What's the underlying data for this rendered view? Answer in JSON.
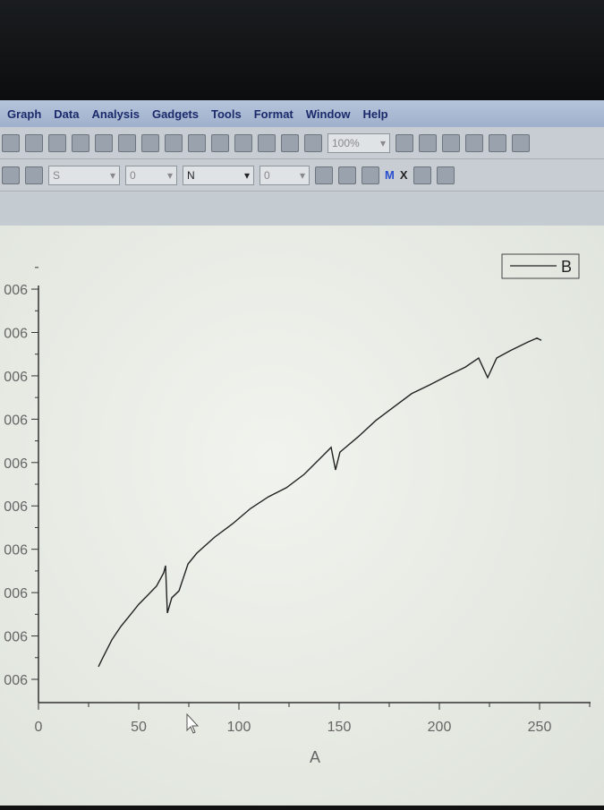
{
  "menu": [
    "Graph",
    "Data",
    "Analysis",
    "Gadgets",
    "Tools",
    "Format",
    "Window",
    "Help"
  ],
  "toolbar": {
    "zoom": "100%",
    "line_style": "S",
    "size1": "0",
    "font": "N",
    "size2": "0",
    "bold_m": "M",
    "x_btn": "X"
  },
  "chart_data": {
    "type": "line",
    "xlabel": "A",
    "ylabel": "",
    "xlim": [
      0,
      275
    ],
    "ylim": [
      -0.5,
      9.5
    ],
    "xticks": [
      0,
      50,
      100,
      150,
      200,
      250
    ],
    "ytick_labels": [
      "006",
      "006",
      "006",
      "006",
      "006",
      "006",
      "006",
      "006",
      "006",
      "006"
    ],
    "legend": {
      "position": "top-right",
      "entries": [
        "B"
      ]
    },
    "grid": false,
    "series": [
      {
        "name": "B",
        "color": "#222222",
        "x": [
          29.9,
          32.1,
          36.6,
          41.1,
          45.5,
          50,
          54.5,
          58.9,
          62.5,
          63.4,
          64.3,
          66.5,
          70.1,
          74.6,
          79,
          87.9,
          96.9,
          105.8,
          114.7,
          123.7,
          132.6,
          141.5,
          146,
          148.2,
          150.4,
          159.4,
          168.3,
          177.2,
          186.2,
          195.1,
          204,
          212.9,
          219.6,
          224.1,
          228.6,
          235.3,
          244.2,
          248.7,
          250.9
        ],
        "y": [
          0.29,
          0.5,
          0.91,
          1.22,
          1.47,
          1.73,
          1.94,
          2.15,
          2.46,
          2.62,
          1.53,
          1.88,
          2.04,
          2.66,
          2.91,
          3.28,
          3.59,
          3.94,
          4.21,
          4.42,
          4.73,
          5.14,
          5.35,
          4.83,
          5.24,
          5.59,
          5.97,
          6.28,
          6.59,
          6.79,
          7.0,
          7.2,
          7.41,
          6.96,
          7.41,
          7.58,
          7.78,
          7.87,
          7.82
        ]
      }
    ]
  }
}
